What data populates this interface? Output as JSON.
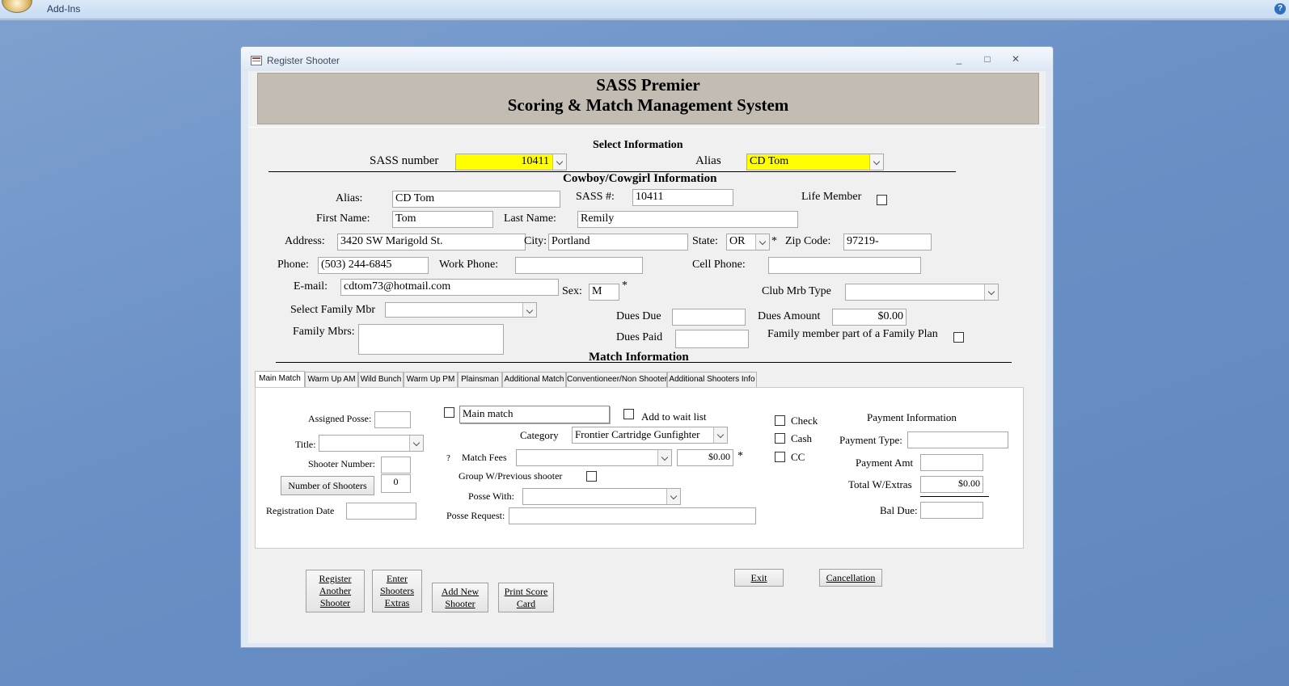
{
  "ribbon": {
    "tab": "Add-Ins",
    "help": "?"
  },
  "window": {
    "title": "Register  Shooter",
    "min": "_",
    "max": "□",
    "close": "✕"
  },
  "header": {
    "line1": "SASS Premier",
    "line2": "Scoring & Match Management System"
  },
  "select_info": {
    "heading": "Select Information",
    "sass_label": "SASS number",
    "sass_value": "10411",
    "alias_label": "Alias",
    "alias_value": "CD Tom"
  },
  "cowboy": {
    "heading": "Cowboy/Cowgirl Information",
    "alias_label": "Alias:",
    "alias_value": "CD Tom",
    "sassnum_label": "SASS #:",
    "sassnum_value": "10411",
    "life_label": "Life Member",
    "first_label": "First Name:",
    "first_value": "Tom",
    "last_label": "Last Name:",
    "last_value": "Remily",
    "address_label": "Address:",
    "address_value": "3420 SW Marigold St.",
    "city_label": "City:",
    "city_value": "Portland",
    "state_label": "State:",
    "state_value": "OR",
    "state_star": "*",
    "zip_label": "Zip Code:",
    "zip_value": "97219-",
    "phone_label": "Phone:",
    "phone_value": "(503) 244-6845",
    "work_label": "Work Phone:",
    "work_value": "",
    "cell_label": "Cell Phone:",
    "cell_value": "",
    "email_label": "E-mail:",
    "email_value": "cdtom73@hotmail.com",
    "sex_label": "Sex:",
    "sex_value": "M",
    "sex_star": "*",
    "clubmbr_label": "Club Mrb Type",
    "clubmbr_value": "",
    "family_sel_label": "Select Family Mbr",
    "family_sel_value": "",
    "dues_due_label": "Dues Due",
    "dues_due_value": "",
    "dues_amount_label": "Dues Amount",
    "dues_amount_value": "$0.00",
    "family_mbrs_label": "Family Mbrs:",
    "family_mbrs_value": "",
    "dues_paid_label": "Dues Paid",
    "dues_paid_value": "",
    "family_plan_label": "Family member part of a Family Plan"
  },
  "match_info": {
    "heading": "Match Information"
  },
  "tabs": [
    "Main Match",
    "Warm Up AM",
    "Wild Bunch",
    "Warm Up PM",
    "Plainsman",
    "Additional Match",
    "Conventioneer/Non Shooter",
    "Additional Shooters Info"
  ],
  "main_match": {
    "posse_label": "Assigned Posse:",
    "posse_value": "",
    "title_label": "Title:",
    "title_value": "",
    "shooter_num_label": "Shooter Number:",
    "shooter_num_value": "",
    "num_shooters_btn": "Number of Shooters",
    "num_shooters_value": "0",
    "reg_date_label": "Registration Date",
    "reg_date_value": "",
    "main_match_field": "Main match",
    "wait_label": "Add to wait list",
    "category_label": "Category",
    "category_value": "Frontier Cartridge Gunfighter",
    "q_mark": "?",
    "fees_label": "Match Fees",
    "fees_value": "",
    "fees_amount": "$0.00",
    "fees_star": "*",
    "group_label": "Group W/Previous shooter",
    "posse_with_label": "Posse With:",
    "posse_with_value": "",
    "posse_req_label": "Posse Request:",
    "posse_req_value": "",
    "check_label": "Check",
    "cash_label": "Cash",
    "cc_label": "CC",
    "pay_heading": "Payment Information",
    "pay_type_label": "Payment Type:",
    "pay_type_value": "",
    "pay_amt_label": "Payment Amt",
    "pay_amt_value": "",
    "total_label": "Total W/Extras",
    "total_value": "$0.00",
    "bal_label": "Bal Due:",
    "bal_value": ""
  },
  "buttons": {
    "register_another": "Register Another Shooter",
    "enter_extras": "Enter Shooters Extras",
    "add_new": "Add New Shooter",
    "print_card": "Print Score Card",
    "exit": "Exit",
    "cancellation": "Cancellation"
  }
}
